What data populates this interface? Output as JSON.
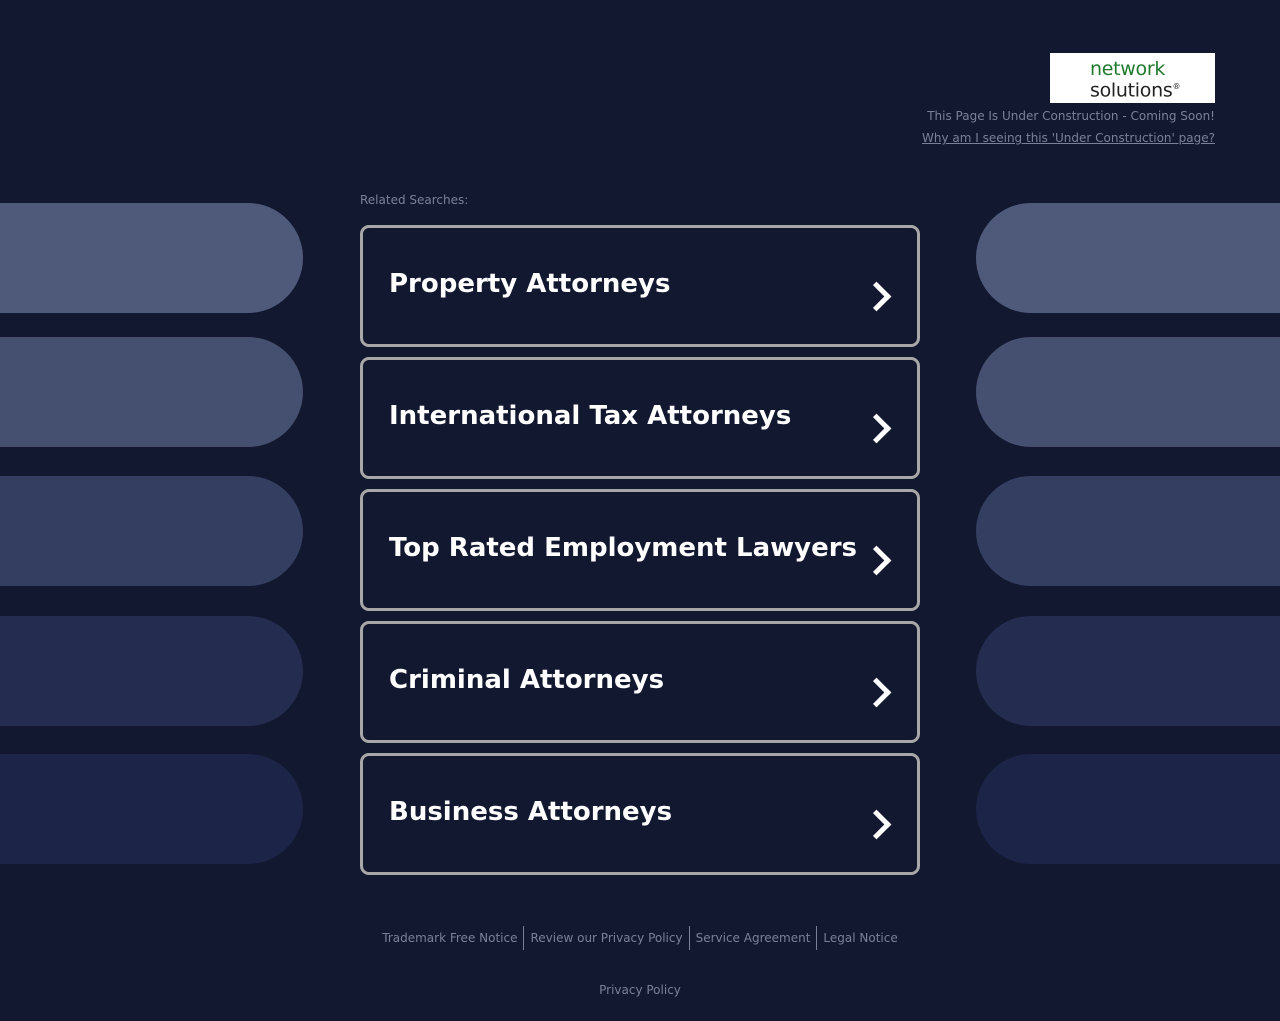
{
  "header": {
    "logo": {
      "line1": "network",
      "line2": "solutions",
      "reg": "®"
    },
    "notice": "This Page Is Under Construction - Coming Soon!",
    "why_link": "Why am I seeing this 'Under Construction' page?"
  },
  "related": {
    "label": "Related Searches:",
    "items": [
      {
        "label": "Property Attorneys"
      },
      {
        "label": "International Tax Attorneys"
      },
      {
        "label": "Top Rated Employment Lawyers"
      },
      {
        "label": "Criminal Attorneys"
      },
      {
        "label": "Business Attorneys"
      }
    ]
  },
  "decor": {
    "pill_colors": [
      "#4f5a7a",
      "#454f70",
      "#343e60",
      "#242d4f",
      "#1c2547"
    ]
  },
  "footer": {
    "links": [
      {
        "label": "Trademark Free Notice"
      },
      {
        "label": "Review our Privacy Policy"
      },
      {
        "label": "Service Agreement"
      },
      {
        "label": "Legal Notice"
      }
    ],
    "privacy": "Privacy Policy"
  }
}
